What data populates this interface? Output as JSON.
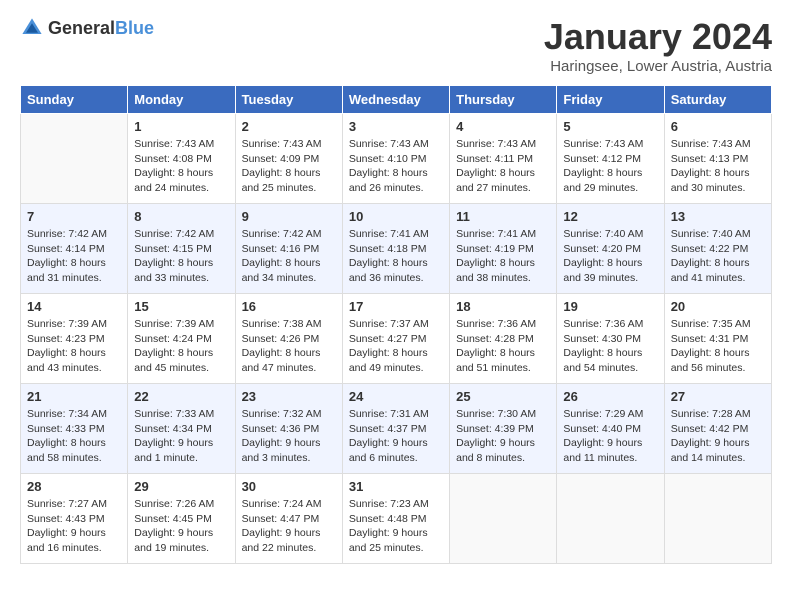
{
  "header": {
    "logo_general": "General",
    "logo_blue": "Blue",
    "month": "January 2024",
    "location": "Haringsee, Lower Austria, Austria"
  },
  "days_of_week": [
    "Sunday",
    "Monday",
    "Tuesday",
    "Wednesday",
    "Thursday",
    "Friday",
    "Saturday"
  ],
  "weeks": [
    [
      {
        "day": null,
        "lines": []
      },
      {
        "day": "1",
        "lines": [
          "Sunrise: 7:43 AM",
          "Sunset: 4:08 PM",
          "Daylight: 8 hours",
          "and 24 minutes."
        ]
      },
      {
        "day": "2",
        "lines": [
          "Sunrise: 7:43 AM",
          "Sunset: 4:09 PM",
          "Daylight: 8 hours",
          "and 25 minutes."
        ]
      },
      {
        "day": "3",
        "lines": [
          "Sunrise: 7:43 AM",
          "Sunset: 4:10 PM",
          "Daylight: 8 hours",
          "and 26 minutes."
        ]
      },
      {
        "day": "4",
        "lines": [
          "Sunrise: 7:43 AM",
          "Sunset: 4:11 PM",
          "Daylight: 8 hours",
          "and 27 minutes."
        ]
      },
      {
        "day": "5",
        "lines": [
          "Sunrise: 7:43 AM",
          "Sunset: 4:12 PM",
          "Daylight: 8 hours",
          "and 29 minutes."
        ]
      },
      {
        "day": "6",
        "lines": [
          "Sunrise: 7:43 AM",
          "Sunset: 4:13 PM",
          "Daylight: 8 hours",
          "and 30 minutes."
        ]
      }
    ],
    [
      {
        "day": "7",
        "lines": [
          "Sunrise: 7:42 AM",
          "Sunset: 4:14 PM",
          "Daylight: 8 hours",
          "and 31 minutes."
        ]
      },
      {
        "day": "8",
        "lines": [
          "Sunrise: 7:42 AM",
          "Sunset: 4:15 PM",
          "Daylight: 8 hours",
          "and 33 minutes."
        ]
      },
      {
        "day": "9",
        "lines": [
          "Sunrise: 7:42 AM",
          "Sunset: 4:16 PM",
          "Daylight: 8 hours",
          "and 34 minutes."
        ]
      },
      {
        "day": "10",
        "lines": [
          "Sunrise: 7:41 AM",
          "Sunset: 4:18 PM",
          "Daylight: 8 hours",
          "and 36 minutes."
        ]
      },
      {
        "day": "11",
        "lines": [
          "Sunrise: 7:41 AM",
          "Sunset: 4:19 PM",
          "Daylight: 8 hours",
          "and 38 minutes."
        ]
      },
      {
        "day": "12",
        "lines": [
          "Sunrise: 7:40 AM",
          "Sunset: 4:20 PM",
          "Daylight: 8 hours",
          "and 39 minutes."
        ]
      },
      {
        "day": "13",
        "lines": [
          "Sunrise: 7:40 AM",
          "Sunset: 4:22 PM",
          "Daylight: 8 hours",
          "and 41 minutes."
        ]
      }
    ],
    [
      {
        "day": "14",
        "lines": [
          "Sunrise: 7:39 AM",
          "Sunset: 4:23 PM",
          "Daylight: 8 hours",
          "and 43 minutes."
        ]
      },
      {
        "day": "15",
        "lines": [
          "Sunrise: 7:39 AM",
          "Sunset: 4:24 PM",
          "Daylight: 8 hours",
          "and 45 minutes."
        ]
      },
      {
        "day": "16",
        "lines": [
          "Sunrise: 7:38 AM",
          "Sunset: 4:26 PM",
          "Daylight: 8 hours",
          "and 47 minutes."
        ]
      },
      {
        "day": "17",
        "lines": [
          "Sunrise: 7:37 AM",
          "Sunset: 4:27 PM",
          "Daylight: 8 hours",
          "and 49 minutes."
        ]
      },
      {
        "day": "18",
        "lines": [
          "Sunrise: 7:36 AM",
          "Sunset: 4:28 PM",
          "Daylight: 8 hours",
          "and 51 minutes."
        ]
      },
      {
        "day": "19",
        "lines": [
          "Sunrise: 7:36 AM",
          "Sunset: 4:30 PM",
          "Daylight: 8 hours",
          "and 54 minutes."
        ]
      },
      {
        "day": "20",
        "lines": [
          "Sunrise: 7:35 AM",
          "Sunset: 4:31 PM",
          "Daylight: 8 hours",
          "and 56 minutes."
        ]
      }
    ],
    [
      {
        "day": "21",
        "lines": [
          "Sunrise: 7:34 AM",
          "Sunset: 4:33 PM",
          "Daylight: 8 hours",
          "and 58 minutes."
        ]
      },
      {
        "day": "22",
        "lines": [
          "Sunrise: 7:33 AM",
          "Sunset: 4:34 PM",
          "Daylight: 9 hours",
          "and 1 minute."
        ]
      },
      {
        "day": "23",
        "lines": [
          "Sunrise: 7:32 AM",
          "Sunset: 4:36 PM",
          "Daylight: 9 hours",
          "and 3 minutes."
        ]
      },
      {
        "day": "24",
        "lines": [
          "Sunrise: 7:31 AM",
          "Sunset: 4:37 PM",
          "Daylight: 9 hours",
          "and 6 minutes."
        ]
      },
      {
        "day": "25",
        "lines": [
          "Sunrise: 7:30 AM",
          "Sunset: 4:39 PM",
          "Daylight: 9 hours",
          "and 8 minutes."
        ]
      },
      {
        "day": "26",
        "lines": [
          "Sunrise: 7:29 AM",
          "Sunset: 4:40 PM",
          "Daylight: 9 hours",
          "and 11 minutes."
        ]
      },
      {
        "day": "27",
        "lines": [
          "Sunrise: 7:28 AM",
          "Sunset: 4:42 PM",
          "Daylight: 9 hours",
          "and 14 minutes."
        ]
      }
    ],
    [
      {
        "day": "28",
        "lines": [
          "Sunrise: 7:27 AM",
          "Sunset: 4:43 PM",
          "Daylight: 9 hours",
          "and 16 minutes."
        ]
      },
      {
        "day": "29",
        "lines": [
          "Sunrise: 7:26 AM",
          "Sunset: 4:45 PM",
          "Daylight: 9 hours",
          "and 19 minutes."
        ]
      },
      {
        "day": "30",
        "lines": [
          "Sunrise: 7:24 AM",
          "Sunset: 4:47 PM",
          "Daylight: 9 hours",
          "and 22 minutes."
        ]
      },
      {
        "day": "31",
        "lines": [
          "Sunrise: 7:23 AM",
          "Sunset: 4:48 PM",
          "Daylight: 9 hours",
          "and 25 minutes."
        ]
      },
      {
        "day": null,
        "lines": []
      },
      {
        "day": null,
        "lines": []
      },
      {
        "day": null,
        "lines": []
      }
    ]
  ]
}
